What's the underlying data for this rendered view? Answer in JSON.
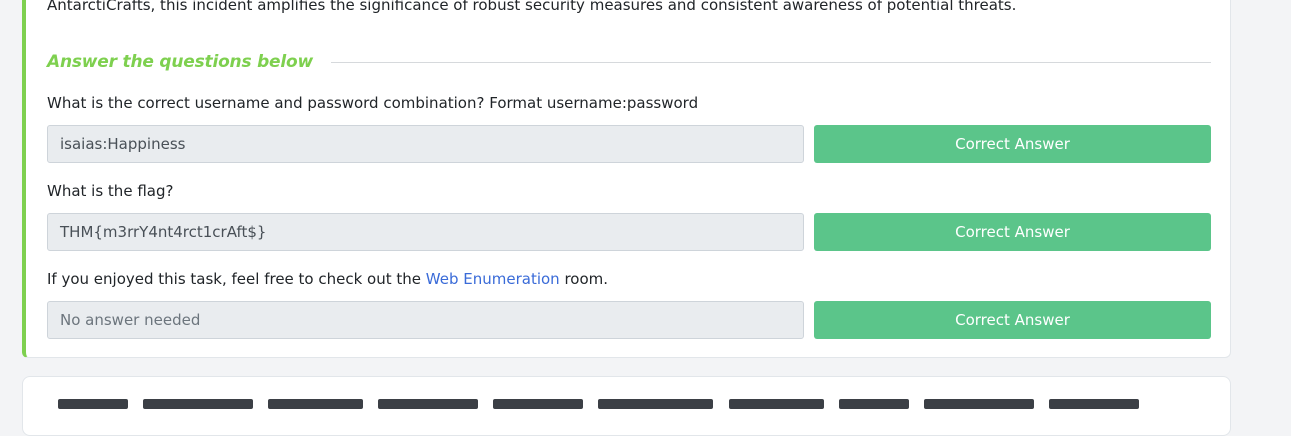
{
  "intro": {
    "text": "AntarctiCrafts, this incident amplifies the significance of robust security measures and consistent awareness of potential threats."
  },
  "questions_section": {
    "title": "Answer the questions below"
  },
  "questions": [
    {
      "prompt": "What is the correct username and password combination? Format username:password",
      "answer": "isaias:Happiness",
      "button_label": "Correct Answer"
    },
    {
      "prompt": "What is the flag?",
      "answer": "THM{m3rrY4nt4rct1crAft$}",
      "button_label": "Correct Answer"
    },
    {
      "prompt_before": "If you enjoyed this task, feel free to check out the ",
      "prompt_link": "Web Enumeration",
      "prompt_after": " room.",
      "answer": "No answer needed",
      "button_label": "Correct Answer"
    }
  ],
  "colors": {
    "accent": "#7ed04f",
    "button": "#5bc58a",
    "link": "#3a6bd8"
  }
}
